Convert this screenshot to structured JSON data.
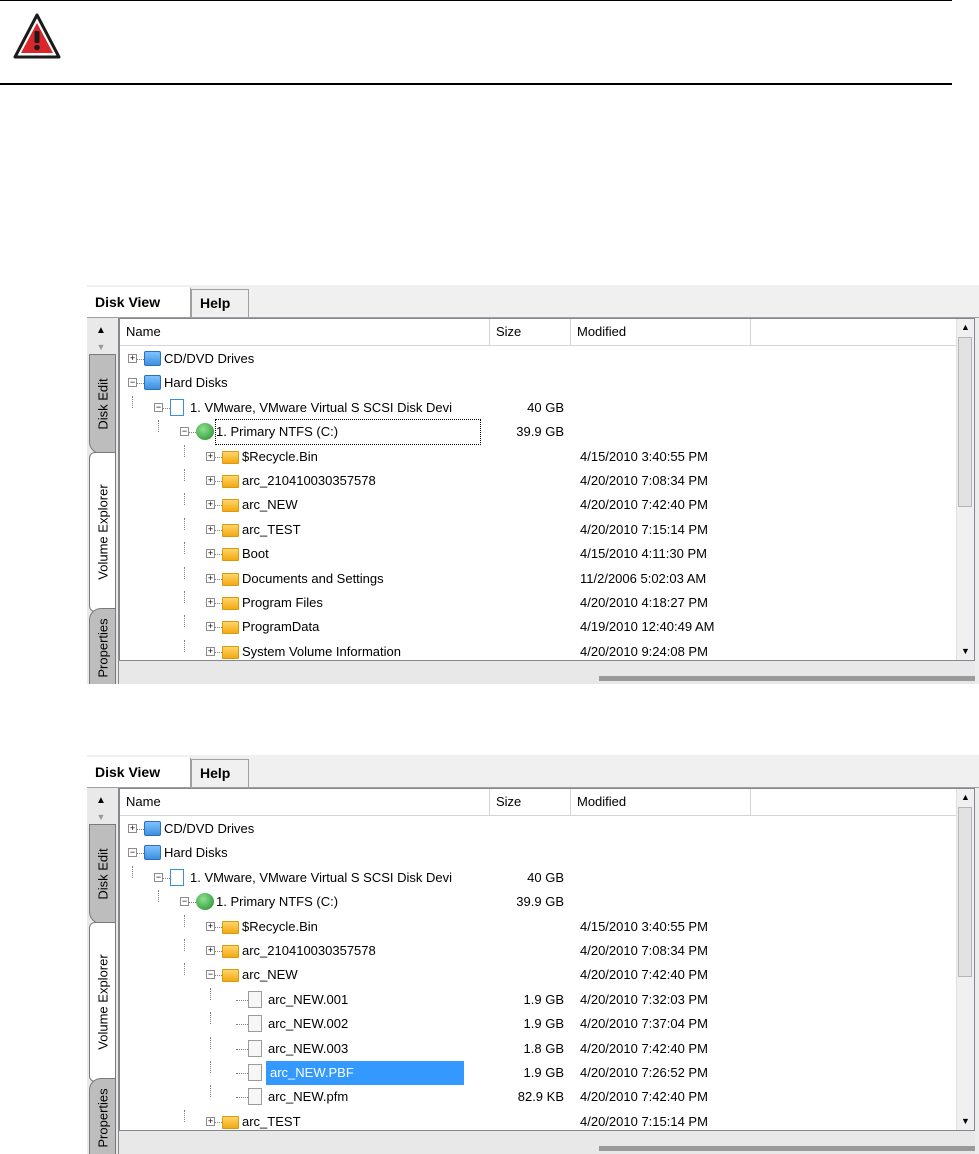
{
  "tabs": {
    "disk_view": "Disk View",
    "help": "Help"
  },
  "side_tabs": {
    "disk_editor": "Disk Edit",
    "volume_explorer": "Volume Explorer",
    "properties": "Properties"
  },
  "columns": {
    "name": "Name",
    "size": "Size",
    "modified": "Modified"
  },
  "panel_a": {
    "rows": [
      {
        "name": "CD/DVD Drives",
        "size": "",
        "modified": "",
        "icon": "drive-icon",
        "indent": 0,
        "expander": "+"
      },
      {
        "name": "Hard Disks",
        "size": "",
        "modified": "",
        "icon": "drive-icon",
        "indent": 0,
        "expander": "-"
      },
      {
        "name": "1. VMware, VMware Virtual S SCSI Disk Devi",
        "size": "40 GB",
        "modified": "",
        "icon": "disk-icon",
        "indent": 1,
        "expander": "-"
      },
      {
        "name": "1. Primary NTFS (C:)",
        "size": "39.9 GB",
        "modified": "",
        "icon": "volume-icon",
        "indent": 2,
        "expander": "-"
      },
      {
        "name": "$Recycle.Bin",
        "size": "",
        "modified": "4/15/2010 3:40:55 PM",
        "icon": "folder-icon",
        "indent": 3,
        "expander": "+"
      },
      {
        "name": "arc_210410030357578",
        "size": "",
        "modified": "4/20/2010 7:08:34 PM",
        "icon": "folder-icon",
        "indent": 3,
        "expander": "+"
      },
      {
        "name": "arc_NEW",
        "size": "",
        "modified": "4/20/2010 7:42:40 PM",
        "icon": "folder-icon",
        "indent": 3,
        "expander": "+"
      },
      {
        "name": "arc_TEST",
        "size": "",
        "modified": "4/20/2010 7:15:14 PM",
        "icon": "folder-icon",
        "indent": 3,
        "expander": "+"
      },
      {
        "name": "Boot",
        "size": "",
        "modified": "4/15/2010 4:11:30 PM",
        "icon": "folder-icon",
        "indent": 3,
        "expander": "+"
      },
      {
        "name": "Documents and Settings",
        "size": "",
        "modified": "11/2/2006 5:02:03 AM",
        "icon": "folder-icon",
        "indent": 3,
        "expander": "+"
      },
      {
        "name": "Program Files",
        "size": "",
        "modified": "4/20/2010 4:18:27 PM",
        "icon": "folder-icon",
        "indent": 3,
        "expander": "+"
      },
      {
        "name": "ProgramData",
        "size": "",
        "modified": "4/19/2010 12:40:49 AM",
        "icon": "folder-icon",
        "indent": 3,
        "expander": "+"
      },
      {
        "name": "System Volume Information",
        "size": "",
        "modified": "4/20/2010 9:24:08 PM",
        "icon": "folder-icon",
        "indent": 3,
        "expander": "+"
      }
    ]
  },
  "panel_b": {
    "rows": [
      {
        "name": "CD/DVD Drives",
        "size": "",
        "modified": "",
        "icon": "drive-icon",
        "indent": 0,
        "expander": "+"
      },
      {
        "name": "Hard Disks",
        "size": "",
        "modified": "",
        "icon": "drive-icon",
        "indent": 0,
        "expander": "-"
      },
      {
        "name": "1. VMware, VMware Virtual S SCSI Disk Devi",
        "size": "40 GB",
        "modified": "",
        "icon": "disk-icon",
        "indent": 1,
        "expander": "-"
      },
      {
        "name": "1. Primary NTFS (C:)",
        "size": "39.9 GB",
        "modified": "",
        "icon": "volume-icon",
        "indent": 2,
        "expander": "-"
      },
      {
        "name": "$Recycle.Bin",
        "size": "",
        "modified": "4/15/2010 3:40:55 PM",
        "icon": "folder-icon",
        "indent": 3,
        "expander": "+"
      },
      {
        "name": "arc_210410030357578",
        "size": "",
        "modified": "4/20/2010 7:08:34 PM",
        "icon": "folder-icon",
        "indent": 3,
        "expander": "+"
      },
      {
        "name": "arc_NEW",
        "size": "",
        "modified": "4/20/2010 7:42:40 PM",
        "icon": "folder-icon",
        "indent": 3,
        "expander": "-"
      },
      {
        "name": "arc_NEW.001",
        "size": "1.9 GB",
        "modified": "4/20/2010 7:32:03 PM",
        "icon": "file-icon",
        "indent": 4,
        "expander": ""
      },
      {
        "name": "arc_NEW.002",
        "size": "1.9 GB",
        "modified": "4/20/2010 7:37:04 PM",
        "icon": "file-icon",
        "indent": 4,
        "expander": ""
      },
      {
        "name": "arc_NEW.003",
        "size": "1.8 GB",
        "modified": "4/20/2010 7:42:40 PM",
        "icon": "file-icon",
        "indent": 4,
        "expander": ""
      },
      {
        "name": "arc_NEW.PBF",
        "size": "1.9 GB",
        "modified": "4/20/2010 7:26:52 PM",
        "icon": "file-icon",
        "indent": 4,
        "expander": "",
        "selected": true
      },
      {
        "name": "arc_NEW.pfm",
        "size": "82.9 KB",
        "modified": "4/20/2010 7:42:40 PM",
        "icon": "file-icon",
        "indent": 4,
        "expander": ""
      },
      {
        "name": "arc_TEST",
        "size": "",
        "modified": "4/20/2010 7:15:14 PM",
        "icon": "folder-icon",
        "indent": 3,
        "expander": "+"
      }
    ]
  },
  "colors": {
    "selection": "#3399ff",
    "folder": "#f2a912",
    "warning": "#d9262b"
  }
}
